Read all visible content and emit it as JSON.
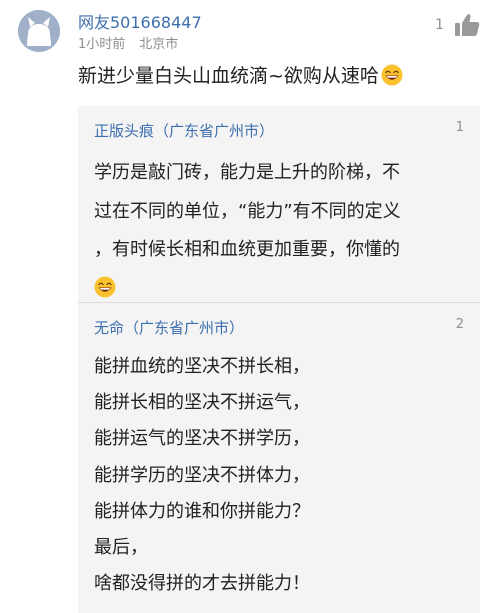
{
  "comment": {
    "username": "网友501668447",
    "time": "1小时前",
    "location": "北京市",
    "like_count": "1",
    "text": "新进少量白头山血统滴~欲购从速哈",
    "emoji": "grinning-emoji"
  },
  "replies": [
    {
      "author": "正版头痕（广东省广州市）",
      "count": "1",
      "lines": [
        "学历是敲门砖，能力是上升的阶梯，不",
        "过在不同的单位，“能力”有不同的定义",
        "，有时候长相和血统更加重要，你懂的"
      ],
      "emoji": "grinning-emoji"
    },
    {
      "author": "无命（广东省广州市）",
      "count": "2",
      "lines": [
        "能拼血统的坚决不拼长相，",
        "能拼长相的坚决不拼运气，",
        "能拼运气的坚决不拼学历，",
        "能拼学历的坚决不拼体力，",
        "能拼体力的谁和你拼能力？",
        "最后，",
        "啥都没得拼的才去拼能力！"
      ]
    }
  ],
  "colors": {
    "username": "#3c6fad",
    "meta": "#8e8e8e",
    "reply_background": "#f4f4f5",
    "emoji_face": "#f9c22e"
  }
}
